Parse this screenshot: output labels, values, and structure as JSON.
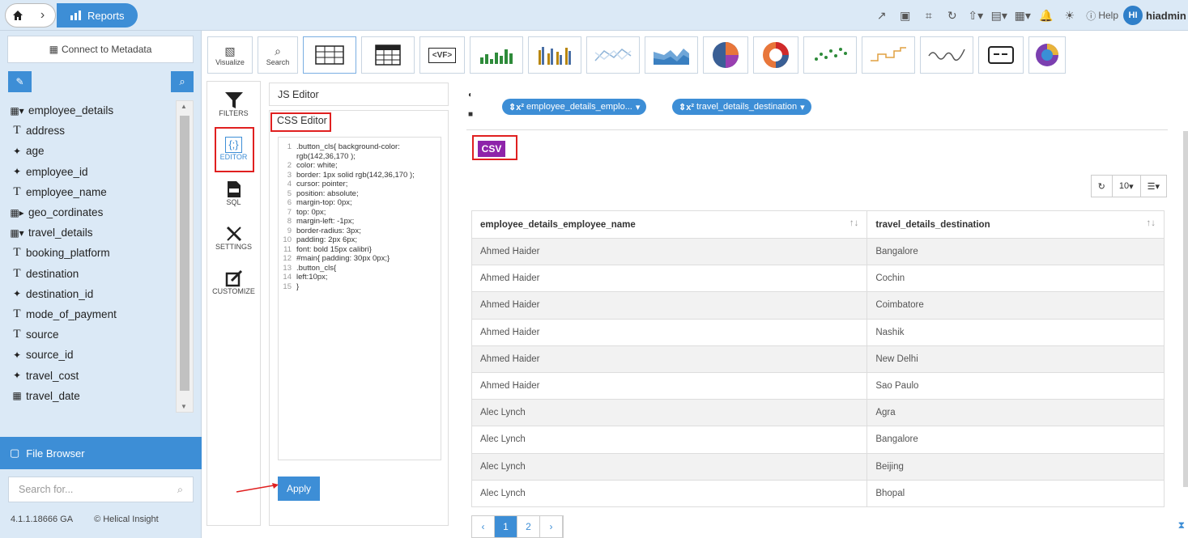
{
  "topbar": {
    "breadcrumb_label": "Reports",
    "help_label": "Help",
    "avatar_initials": "HI",
    "username": "hiadmin"
  },
  "sidebar": {
    "connect_label": "Connect to Metadata",
    "items": [
      {
        "icon": "table-expand-icon",
        "label": "employee_details"
      },
      {
        "icon": "text-icon",
        "label": "address"
      },
      {
        "icon": "numeric-icon",
        "label": "age"
      },
      {
        "icon": "numeric-icon",
        "label": "employee_id"
      },
      {
        "icon": "text-icon",
        "label": "employee_name"
      },
      {
        "icon": "table-collapse-icon",
        "label": "geo_cordinates"
      },
      {
        "icon": "table-expand-icon",
        "label": "travel_details"
      },
      {
        "icon": "text-icon",
        "label": "booking_platform"
      },
      {
        "icon": "text-icon",
        "label": "destination"
      },
      {
        "icon": "numeric-icon",
        "label": "destination_id"
      },
      {
        "icon": "text-icon",
        "label": "mode_of_payment"
      },
      {
        "icon": "text-icon",
        "label": "source"
      },
      {
        "icon": "numeric-icon",
        "label": "source_id"
      },
      {
        "icon": "numeric-icon",
        "label": "travel_cost"
      },
      {
        "icon": "date-icon",
        "label": "travel_date"
      }
    ],
    "file_browser_label": "File Browser",
    "search_placeholder": "Search for...",
    "version": "4.1.1.18666 GA",
    "copyright": "© Helical Insight"
  },
  "chart_toolbar": {
    "visualize_label": "Visualize",
    "search_label": "Search"
  },
  "left_strip": {
    "filters_label": "FILTERS",
    "editor_label": "EDITOR",
    "sql_label": "SQL",
    "settings_label": "SETTINGS",
    "customize_label": "CUSTOMIZE"
  },
  "editor": {
    "js_tab_label": "JS Editor",
    "css_tab_label": "CSS Editor",
    "apply_label": "Apply",
    "code_lines": [
      {
        "n": "1",
        "text": ".button_cls{     background-color: rgb(142,36,170 );"
      },
      {
        "n": "2",
        "text": "color: white;"
      },
      {
        "n": "3",
        "text": "border: 1px solid rgb(142,36,170 );"
      },
      {
        "n": "4",
        "text": "cursor: pointer;"
      },
      {
        "n": "5",
        "text": "position: absolute;"
      },
      {
        "n": "6",
        "text": "margin-top: 0px;"
      },
      {
        "n": "7",
        "text": "top: 0px;"
      },
      {
        "n": "8",
        "text": "margin-left: -1px;"
      },
      {
        "n": "9",
        "text": "border-radius: 3px;"
      },
      {
        "n": "10",
        "text": "padding: 2px 6px;"
      },
      {
        "n": "11",
        "text": "font: bold 15px calibri}"
      },
      {
        "n": "12",
        "text": "#main{   padding: 30px 0px;}"
      },
      {
        "n": "13",
        "text": ".button_cls{"
      },
      {
        "n": "14",
        "text": "left:10px;"
      },
      {
        "n": "15",
        "text": "}"
      }
    ]
  },
  "canvas": {
    "filter_pill_1": "employee_details_emplo...",
    "filter_pill_2": "travel_details_destination",
    "csv_label": "CSV",
    "page_size": "10",
    "columns": [
      "employee_details_employee_name",
      "travel_details_destination"
    ],
    "rows": [
      [
        "Ahmed Haider",
        "Bangalore"
      ],
      [
        "Ahmed Haider",
        "Cochin"
      ],
      [
        "Ahmed Haider",
        "Coimbatore"
      ],
      [
        "Ahmed Haider",
        "Nashik"
      ],
      [
        "Ahmed Haider",
        "New Delhi"
      ],
      [
        "Ahmed Haider",
        "Sao Paulo"
      ],
      [
        "Alec Lynch",
        "Agra"
      ],
      [
        "Alec Lynch",
        "Bangalore"
      ],
      [
        "Alec Lynch",
        "Beijing"
      ],
      [
        "Alec Lynch",
        "Bhopal"
      ]
    ],
    "pages": [
      "1",
      "2"
    ],
    "current_page": "1"
  },
  "colors": {
    "accent": "#3d8ed6",
    "csv_purple": "#8e24aa",
    "highlight_red": "#e02020"
  }
}
